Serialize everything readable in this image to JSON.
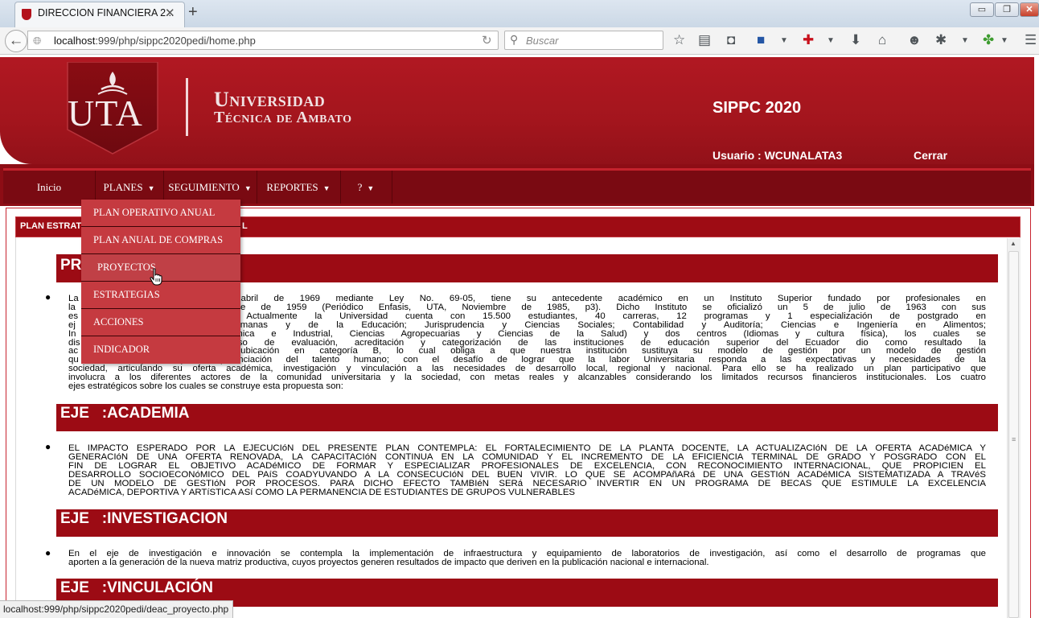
{
  "browser": {
    "tab_title": "DIRECCION FINANCIERA 2...",
    "tab_close": "✕",
    "new_tab": "+",
    "window_controls": {
      "minimize": "▭",
      "maximize": "❐",
      "close": "✕"
    },
    "url_host": "localhost",
    "url_rest": ":999/php/sippc2020pedi/home.php",
    "search_placeholder": "Buscar",
    "toolbar_icons": [
      "star-icon",
      "reading-list-icon",
      "pocket-icon",
      "save-icon",
      "dropdown-icon",
      "addon-red-cross-icon",
      "dropdown-icon",
      "download-icon",
      "home-icon",
      "emoji-icon",
      "bug-icon",
      "dropdown-icon",
      "puzzle-icon",
      "dropdown-icon",
      "menu-icon"
    ],
    "status_url": "localhost:999/php/sippc2020pedi/deac_proyecto.php"
  },
  "header": {
    "logo_text": "UTA",
    "university_line1": "Universidad",
    "university_line2": "Técnica de Ambato",
    "app_title": "SIPPC 2020",
    "user_label": "Usuario : WCUNALATA3",
    "logout_label": "Cerrar"
  },
  "menu": {
    "items": [
      {
        "label": "Inicio",
        "has_caret": false
      },
      {
        "label": "PLANES",
        "has_caret": true
      },
      {
        "label": "SEGUIMIENTO",
        "has_caret": true
      },
      {
        "label": "REPORTES",
        "has_caret": true
      },
      {
        "label": "?",
        "has_caret": true
      }
    ],
    "caret": "▼",
    "planes_dropdown": [
      "PLAN OPERATIVO ANUAL",
      "PLAN ANUAL DE COMPRAS",
      "PROYECTOS",
      "ESTRATEGIAS",
      "ACCIONES",
      "INDICADOR"
    ],
    "hovered_item": "PROYECTOS"
  },
  "panel": {
    "title_left": "PLAN ESTRATE",
    "title_right": "L"
  },
  "sections": [
    {
      "title": "PR",
      "lines": [
        "La fue creada el 18 de abril de 1969 mediante Ley No. 69-05, tiene su antecedente académico en un Instituto Superior fundado por profesionales en",
        "la creó un 13 de septiembre de 1959 (Periódico Enfasis, UTA, Noviembre de 1985, p3). Dicho Instituto se oficializó un 5 de julio de 1963 con sus",
        "es a y Técnica Industrial. Actualmente la Universidad cuenta con 15.500 estudiantes, 40 carreras, 12 programas y 1 especialización de postgrado en",
        "ej Administrativas; Ciencias Humanas y de la Educación; Jurisprudencia y Ciencias Sociales; Contabilidad y Auditoría; Ciencias e Ingeniería en Alimentos;",
        "In ería en Sistemas; Electrónica e Industrial, Ciencias Agropecuarias y Ciencias de la Salud) y dos centros (Idiomas y cultura física), los cuales se",
        "dis itarios. El reciente proceso de evaluación, acreditación y categorización de las instituciones de educación superior del Ecuador dio como resultado la",
        "ac nica de Ambato y su ubicación en categoría B, lo cual obliga a que nuestra institución sustituya su modelo de gestión por un modelo de gestión",
        "qu la investigación y la potenciación del talento humano; con el desafío de lograr que la labor Universitaria responda a las expectativas y necesidades de la",
        "sociedad, articulando su oferta académica, investigación y vinculación a las necesidades de desarrollo local, regional y nacional. Para ello se ha realizado un plan participativo que",
        "involucra a los diferentes actores de la comunidad universitaria y la sociedad, con metas reales y alcanzables considerando los limitados recursos financieros institucionales. Los cuatro",
        "ejes estratégicos sobre los cuales se construye esta propuesta son:"
      ]
    },
    {
      "title": "EJE   :ACADEMIA",
      "lines": [
        "EL IMPACTO ESPERADO POR LA EJECUCIóN DEL PRESENTE PLAN CONTEMPLA: EL FORTALECIMIENTO DE LA PLANTA DOCENTE, LA ACTUALIZACIóN DE LA OFERTA ACADéMICA Y",
        "GENERACIóN DE UNA OFERTA RENOVADA, LA CAPACITACIóN CONTINUA EN LA COMUNIDAD Y EL INCREMENTO DE LA EFICIENCIA TERMINAL DE GRADO Y POSGRADO CON EL",
        "FIN DE LOGRAR EL OBJETIVO ACADéMICO DE FORMAR Y ESPECIALIZAR PROFESIONALES DE EXCELENCIA, CON RECONOCIMIENTO INTERNACIONAL, QUE PROPICIEN EL",
        "DESARROLLO SOCIOECONóMICO DEL PAíS COADYUVANDO A LA CONSECUCIóN DEL BUEN VIVIR. LO QUE SE ACOMPAñARá DE UNA GESTIóN ACADéMICA SISTEMATIZADA A TRAVéS",
        "DE UN MODELO DE GESTIóN POR PROCESOS. PARA DICHO EFECTO TAMBIéN SERá NECESARIO INVERTIR EN UN PROGRAMA DE BECAS QUE ESTIMULE LA EXCELENCIA",
        "ACADéMICA, DEPORTIVA Y ARTíSTICA ASí COMO LA PERMANENCIA DE ESTUDIANTES DE GRUPOS VULNERABLES"
      ]
    },
    {
      "title": "EJE   :INVESTIGACION",
      "lines": [
        "En el eje de investigación e innovación se contempla la implementación de infraestructura y equipamiento de laboratorios de investigación, así como el desarrollo de programas que",
        "aporten a la generación de la nueva matriz productiva, cuyos proyectos generen resultados de impacto que deriven en la publicación nacional e internacional."
      ]
    },
    {
      "title": "EJE   :VINCULACIÓN",
      "lines": []
    }
  ],
  "colors": {
    "brand_red": "#a3151d",
    "menu_dark": "#7a0a12",
    "section_bar": "#9c0b14",
    "dropdown": "#c53a40"
  }
}
